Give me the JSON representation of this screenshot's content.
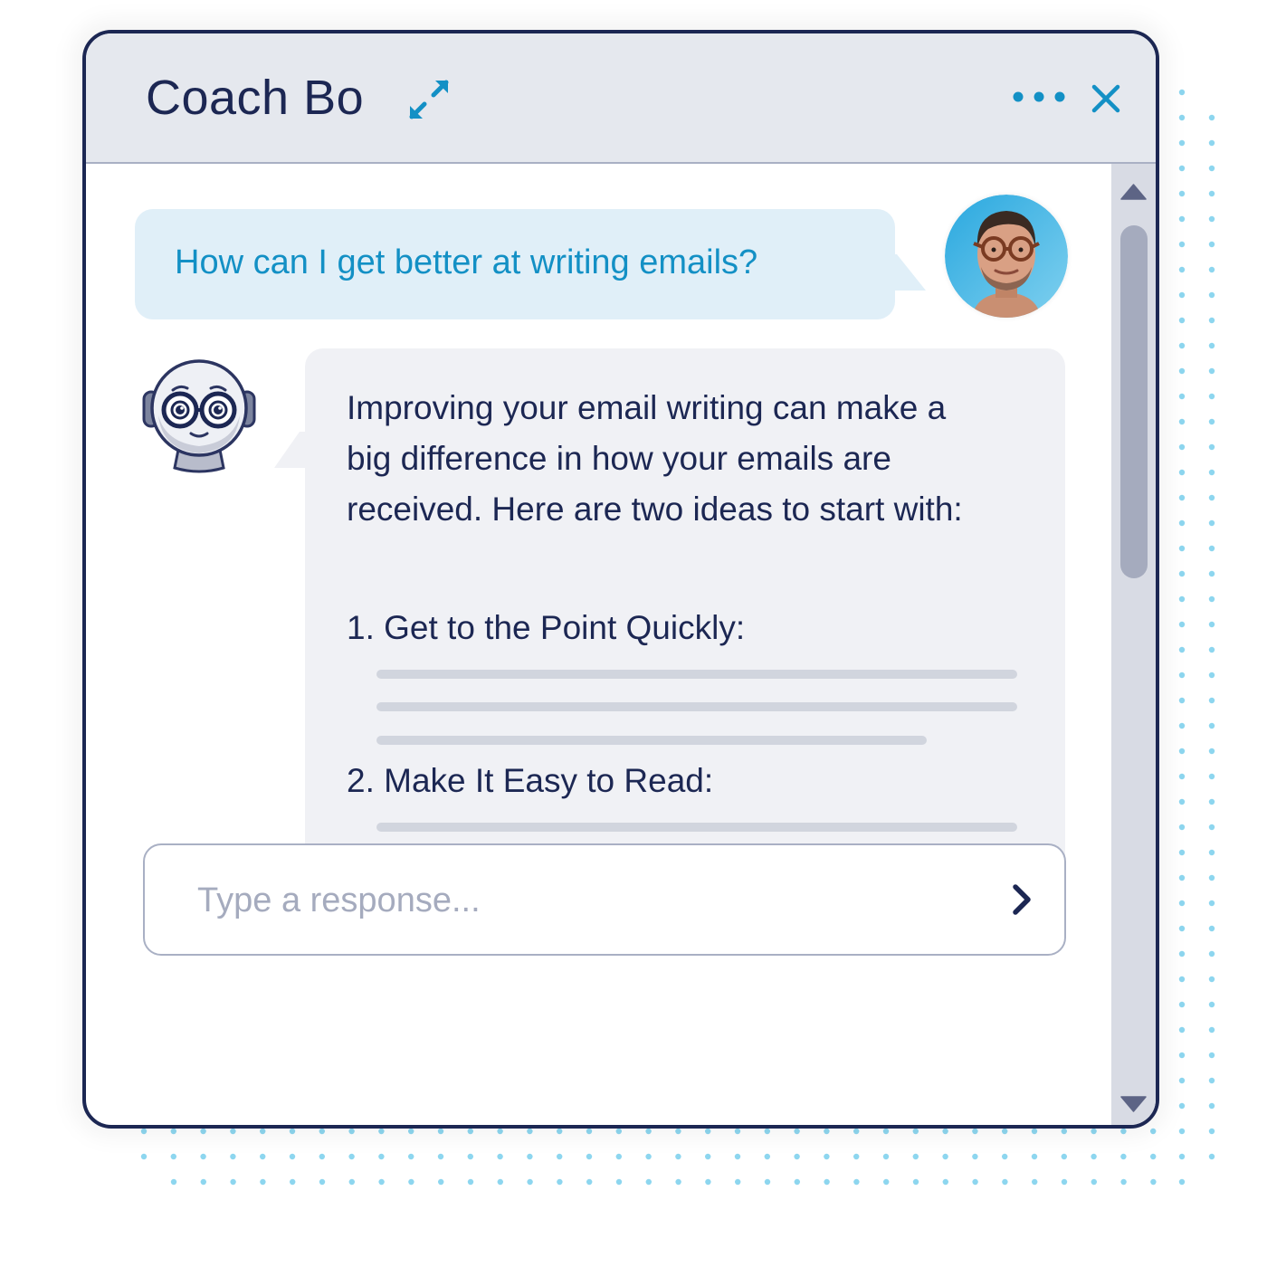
{
  "window": {
    "title": "Coach Bo",
    "icons": {
      "expand": "expand-arrows-icon",
      "more": "more-horizontal-icon",
      "close": "close-icon"
    }
  },
  "colors": {
    "accent": "#1390c5",
    "navy": "#1c2753",
    "titlebar_bg": "#e5e8ee",
    "user_bubble_bg": "#e0eff8",
    "bot_bubble_bg": "#f0f1f5",
    "placeholder_line": "#d1d5de",
    "dot_pattern": "#8dd6ef",
    "scrollbar_track": "#d8dbe4",
    "scrollbar_thumb": "#a5abbe"
  },
  "conversation": {
    "user_message": {
      "text": "How can I get better at writing emails?",
      "avatar": "user-photo-avatar"
    },
    "bot_message": {
      "avatar": "coach-bo-robot-avatar",
      "intro": "Improving your email writing can make a big difference in how your emails are received. Here are two ideas to start with:",
      "tips": [
        {
          "heading": "1. Get to the Point Quickly:",
          "placeholder_lines": 3
        },
        {
          "heading": "2. Make It Easy to Read:",
          "placeholder_lines": 3
        }
      ]
    }
  },
  "composer": {
    "placeholder": "Type a response...",
    "value": "",
    "send_icon": "chevron-right-icon"
  },
  "scrollbar": {
    "up_icon": "triangle-up-icon",
    "down_icon": "triangle-down-icon"
  }
}
